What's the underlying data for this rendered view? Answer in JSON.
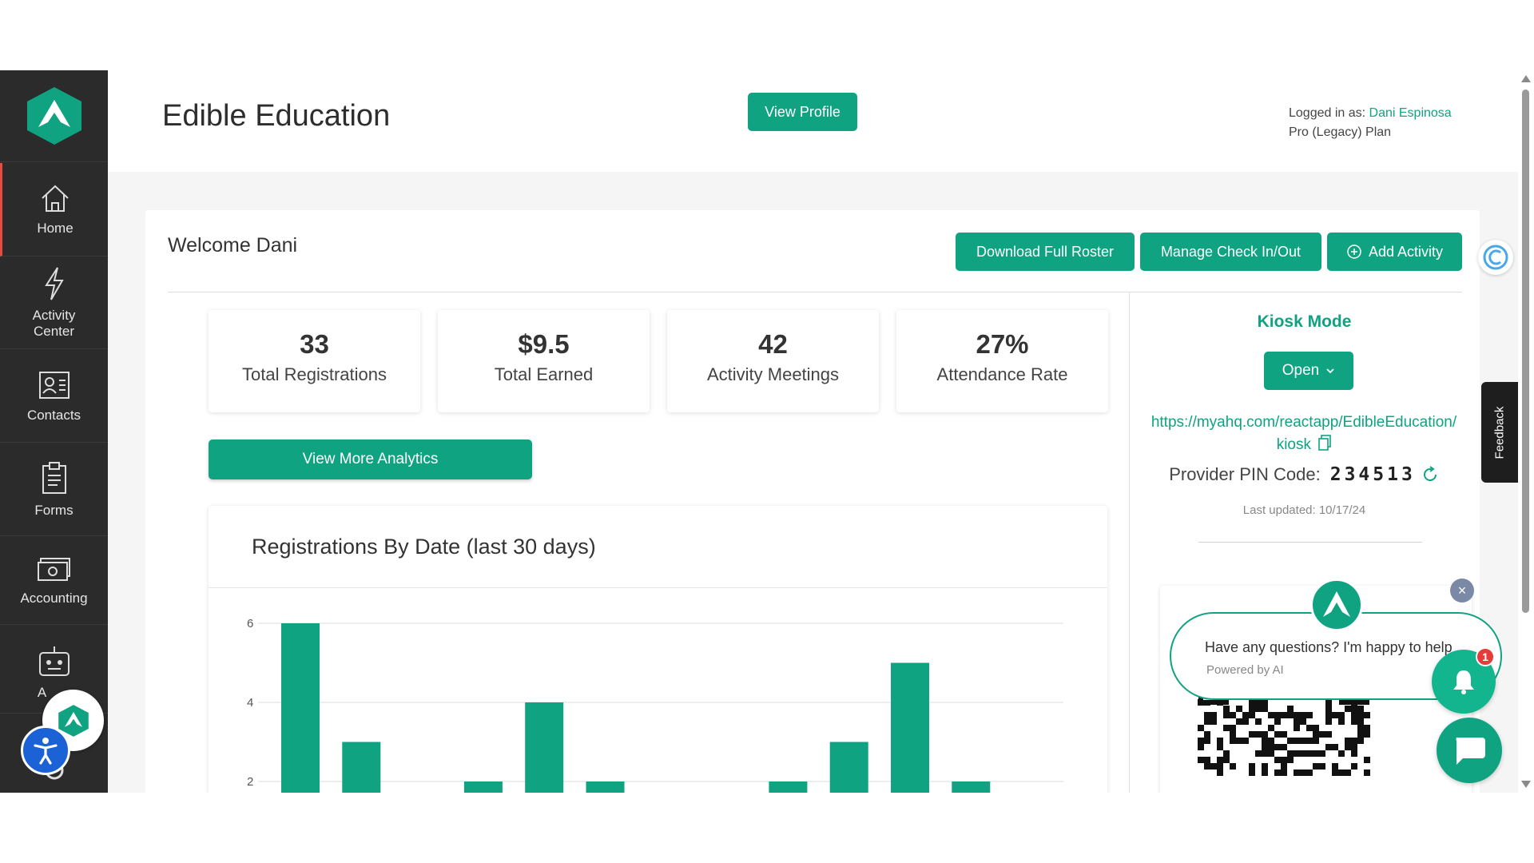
{
  "header": {
    "org_name": "Edible Education",
    "view_profile_label": "View Profile",
    "logged_in_prefix": "Logged in as: ",
    "user_name": "Dani Espinosa",
    "plan": "Pro (Legacy) Plan"
  },
  "sidebar": {
    "items": [
      {
        "label": "Home",
        "icon": "home-icon"
      },
      {
        "label": "Activity Center",
        "icon": "lightning-icon"
      },
      {
        "label": "Contacts",
        "icon": "contacts-icon"
      },
      {
        "label": "Forms",
        "icon": "clipboard-icon"
      },
      {
        "label": "Accounting",
        "icon": "money-icon"
      },
      {
        "label": "A",
        "icon": "robot-icon"
      }
    ]
  },
  "main": {
    "welcome": "Welcome Dani",
    "actions": {
      "download_roster": "Download Full Roster",
      "manage_check": "Manage Check In/Out",
      "add_activity": "Add Activity"
    },
    "stats": [
      {
        "value": "33",
        "label": "Total Registrations"
      },
      {
        "value": "$9.5",
        "label": "Total Earned"
      },
      {
        "value": "42",
        "label": "Activity Meetings"
      },
      {
        "value": "27%",
        "label": "Attendance Rate"
      }
    ],
    "analytics_button": "View More Analytics"
  },
  "chart_data": {
    "type": "bar",
    "title": "Registrations By Date (last 30 days)",
    "y_ticks": [
      "6",
      "4",
      "2"
    ],
    "values": [
      6,
      3,
      0,
      2,
      4,
      2,
      0,
      0,
      2,
      3,
      5,
      2
    ],
    "color": "#0fa381"
  },
  "kiosk": {
    "title": "Kiosk Mode",
    "open_label": "Open",
    "url": "https://myahq.com/reactapp/EdibleEducation/kiosk",
    "pin_label": "Provider PIN Code:",
    "pin_code": "234513",
    "last_updated": "Last updated: 10/17/24"
  },
  "chat": {
    "message": "Have any questions? I'm happy to help",
    "powered": "Powered by AI",
    "badge": "1"
  },
  "feedback_label": "Feedback",
  "colors": {
    "accent": "#0fa381",
    "sidebar": "#2b2b2b",
    "a11y": "#1a62d6"
  }
}
